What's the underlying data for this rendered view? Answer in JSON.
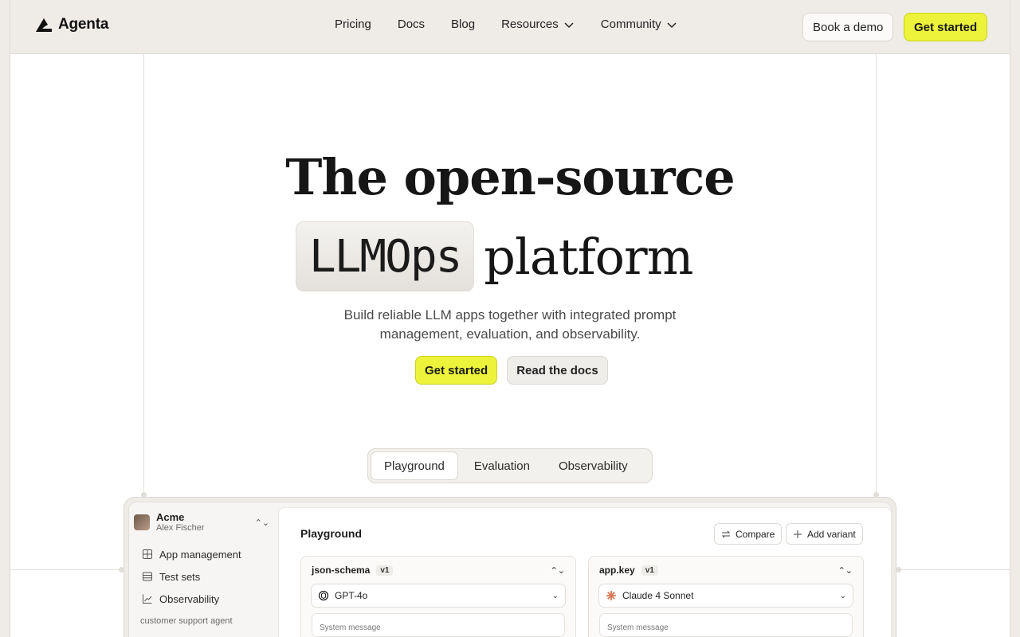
{
  "brand": {
    "name": "Agenta"
  },
  "nav": {
    "items": [
      {
        "label": "Pricing"
      },
      {
        "label": "Docs"
      },
      {
        "label": "Blog"
      },
      {
        "label": "Resources"
      },
      {
        "label": "Community"
      }
    ],
    "book_demo": "Book a demo",
    "get_started": "Get started"
  },
  "hero": {
    "line1": "The open-source",
    "highlight": "LLMOps",
    "line2_rest": "platform",
    "subtitle_1": "Build reliable LLM apps together with integrated prompt",
    "subtitle_2": "management, evaluation, and observability.",
    "cta_primary": "Get started",
    "cta_secondary": "Read the docs"
  },
  "tabs": [
    {
      "label": "Playground",
      "active": true
    },
    {
      "label": "Evaluation",
      "active": false
    },
    {
      "label": "Observability",
      "active": false
    }
  ],
  "app": {
    "org": "Acme",
    "user": "Alex Fischer",
    "sidebar": [
      {
        "label": "App management",
        "icon": "grid-icon"
      },
      {
        "label": "Test sets",
        "icon": "table-icon"
      },
      {
        "label": "Observability",
        "icon": "chart-icon"
      }
    ],
    "section": "customer support agent",
    "panel_title": "Playground",
    "compare": "Compare",
    "add_variant": "Add variant",
    "variants": [
      {
        "name": "json-schema",
        "version": "v1",
        "model": "GPT-4o",
        "system_placeholder": "System message"
      },
      {
        "name": "app.key",
        "version": "v1",
        "model": "Claude 4 Sonnet",
        "system_placeholder": "System message"
      }
    ]
  },
  "colors": {
    "accent": "#ecf33a",
    "background": "#efece8"
  }
}
